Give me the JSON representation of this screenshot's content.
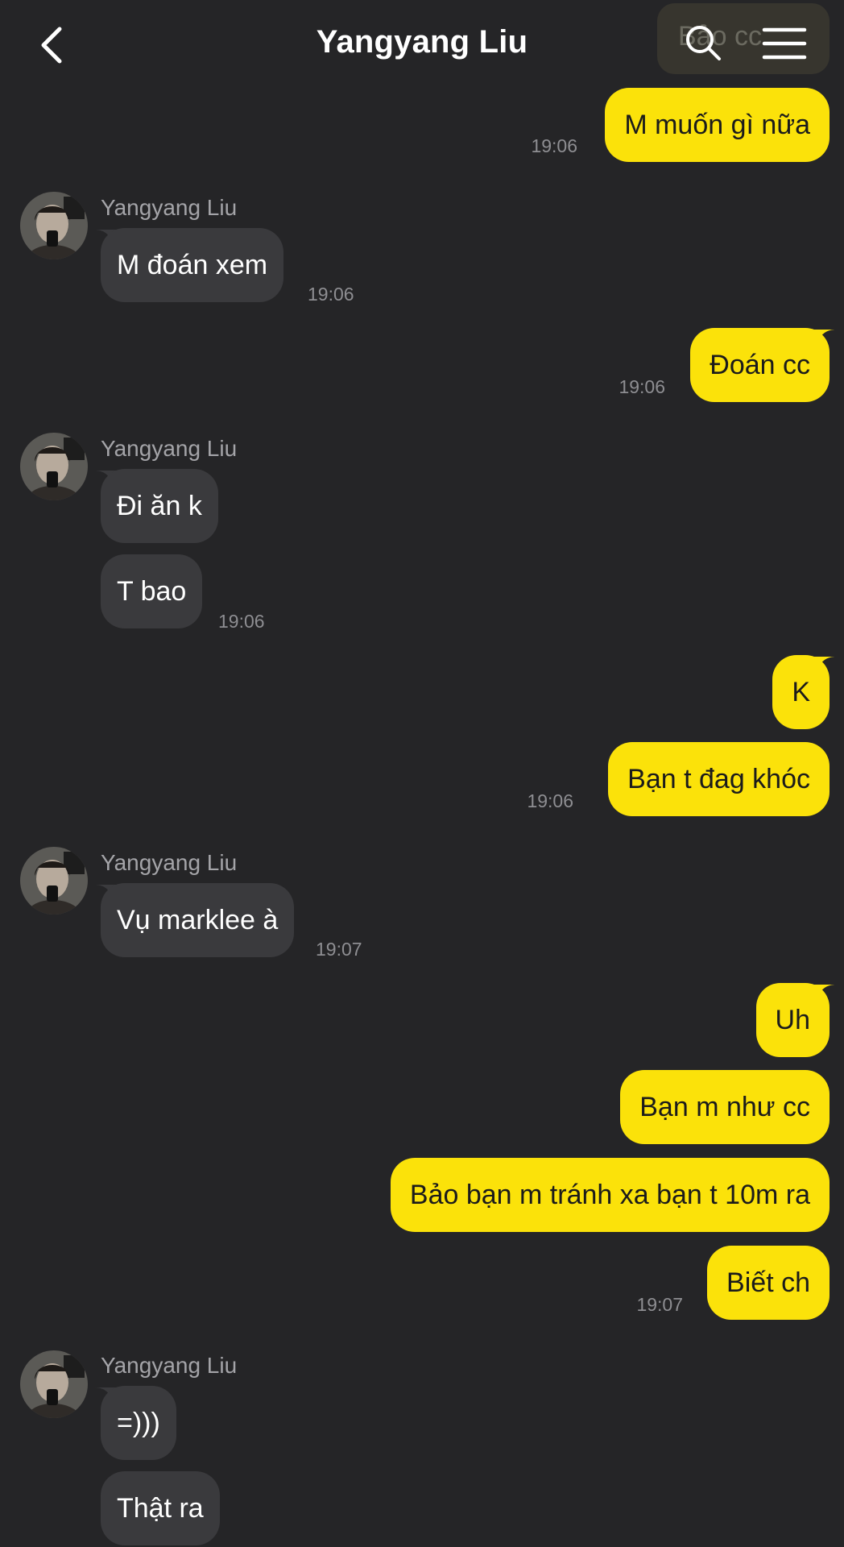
{
  "header": {
    "back_icon": "chevron-left-icon",
    "title": "Yangyang Liu",
    "pill_text": "Bảo cc",
    "search_icon": "search-icon",
    "menu_icon": "menu-icon"
  },
  "colors": {
    "background": "#252527",
    "my_bubble": "#fbe20a",
    "their_bubble": "#3a3a3d",
    "timestamp": "#8e8e92"
  },
  "messages": [
    {
      "from": "me",
      "text": "M muốn gì nữa",
      "time": "19:06"
    },
    {
      "from": "them",
      "sender": "Yangyang Liu",
      "text": "M đoán xem",
      "time": "19:06"
    },
    {
      "from": "me",
      "text": "Đoán cc",
      "time": "19:06"
    },
    {
      "from": "them",
      "sender": "Yangyang Liu",
      "text": "Đi ăn k"
    },
    {
      "from": "them",
      "text": "T bao",
      "time": "19:06"
    },
    {
      "from": "me",
      "text": "K"
    },
    {
      "from": "me",
      "text": "Bạn t đag khóc",
      "time": "19:06"
    },
    {
      "from": "them",
      "sender": "Yangyang Liu",
      "text": "Vụ marklee à",
      "time": "19:07"
    },
    {
      "from": "me",
      "text": "Uh"
    },
    {
      "from": "me",
      "text": "Bạn m như cc"
    },
    {
      "from": "me",
      "text": "Bảo bạn m tránh xa bạn t 10m ra"
    },
    {
      "from": "me",
      "text": "Biết ch",
      "time": "19:07"
    },
    {
      "from": "them",
      "sender": "Yangyang Liu",
      "text": "=)))"
    },
    {
      "from": "them",
      "text": "Thật ra"
    }
  ]
}
